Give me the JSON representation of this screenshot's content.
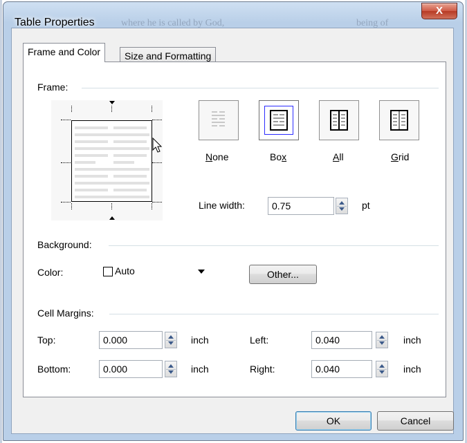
{
  "window": {
    "title": "Table Properties",
    "background_text": "where he is called by God,",
    "background_text_right": "being of",
    "close_glyph": "X"
  },
  "tabs": [
    {
      "label": "Frame and Color",
      "active": true
    },
    {
      "label": "Size and Formatting",
      "active": false
    }
  ],
  "frame": {
    "section_label": "Frame:",
    "options": [
      {
        "mnemonic": "N",
        "rest": "one",
        "selected": false
      },
      {
        "pre": "Bo",
        "mnemonic": "x",
        "selected": true
      },
      {
        "mnemonic": "A",
        "rest": "ll",
        "selected": false
      },
      {
        "mnemonic": "G",
        "rest": "rid",
        "selected": false
      }
    ],
    "line_width_label": "Line width:",
    "line_width_value": "0.75",
    "line_width_unit": "pt"
  },
  "background": {
    "section_label": "Background:",
    "color_label": "Color:",
    "color_value": "Auto",
    "other_button": "Other..."
  },
  "cell_margins": {
    "section_label": "Cell Margins:",
    "top_label": "Top:",
    "top_value": "0.000",
    "bottom_label": "Bottom:",
    "bottom_value": "0.000",
    "left_label": "Left:",
    "left_value": "0.040",
    "right_label": "Right:",
    "right_value": "0.040",
    "unit": "inch"
  },
  "footer": {
    "ok": "OK",
    "cancel": "Cancel"
  },
  "colors": {
    "selected_border": "#2b2bff",
    "title_bar": "#b9cfe8",
    "close_button": "#c9462f",
    "panel": "#ffffff",
    "dialog": "#f0f0f0"
  }
}
